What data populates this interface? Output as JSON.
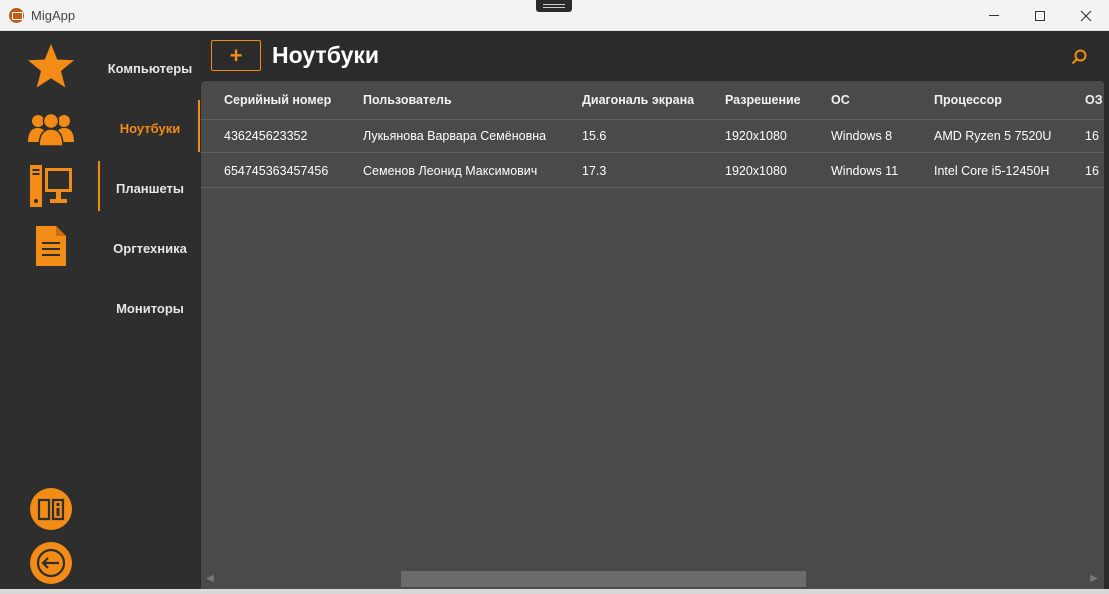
{
  "window": {
    "title": "MigApp"
  },
  "rail": {
    "icons": [
      "star-icon",
      "users-icon",
      "computer-icon",
      "document-icon"
    ],
    "bottom_icons": [
      "info-book-icon",
      "logout-icon"
    ]
  },
  "categories": [
    {
      "label": "Компьютеры",
      "active": false
    },
    {
      "label": "Ноутбуки",
      "active": true
    },
    {
      "label": "Планшеты",
      "active": false
    },
    {
      "label": "Оргтехника",
      "active": false
    },
    {
      "label": "Мониторы",
      "active": false
    }
  ],
  "page": {
    "add_label": "+",
    "title": "Ноутбуки"
  },
  "table": {
    "columns": [
      "Серийный номер",
      "Пользователь",
      "Диагональ экрана",
      "Разрешение",
      "ОС",
      "Процессор",
      "ОЗ"
    ],
    "rows": [
      [
        "436245623352",
        "Лукьянова Варвара Семёновна",
        "15.6",
        "1920x1080",
        "Windows 8",
        "AMD Ryzen 5 7520U",
        "16"
      ],
      [
        "654745363457456",
        "Семенов Леонид Максимович",
        "17.3",
        "1920x1080",
        "Windows 11",
        "Intel Core i5-12450H",
        "16"
      ]
    ]
  },
  "colors": {
    "accent": "#f28c16",
    "background": "#2b2b2b",
    "grid": "#4a4a4a"
  }
}
